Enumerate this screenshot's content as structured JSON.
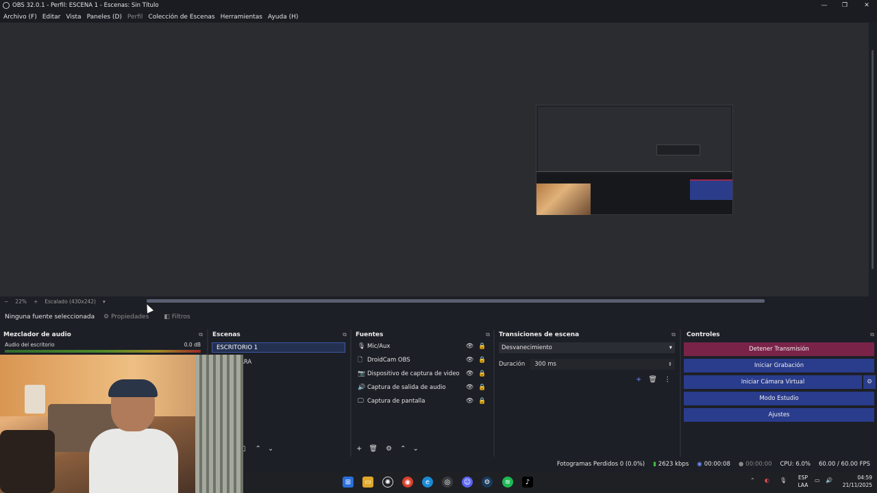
{
  "window": {
    "title": "OBS 32.0.1 - Perfil: ESCENA 1 - Escenas: Sin Título"
  },
  "menu": [
    "Archivo (F)",
    "Editar",
    "Vista",
    "Paneles (D)",
    "Perfil",
    "Colección de Escenas",
    "Herramientas",
    "Ayuda (H)"
  ],
  "zoom": {
    "minus": "−",
    "value": "22%",
    "plus": "+",
    "scale_label": "Escalado (430x242)"
  },
  "source_bar": {
    "no_source": "Ninguna fuente seleccionada",
    "properties": "Propiedades",
    "filters": "Filtros"
  },
  "mixer": {
    "title": "Mezclador de audio",
    "track_name": "Audio del escritorio",
    "track_db": "0.0 dB"
  },
  "scenes": {
    "title": "Escenas",
    "items": [
      "ESCRITORIO 1",
      "ARA"
    ]
  },
  "sources": {
    "title": "Fuentes",
    "items": [
      {
        "icon": "mic-icon",
        "glyph": "🎙",
        "label": "Mic/Aux"
      },
      {
        "icon": "file-icon",
        "glyph": "🗋",
        "label": "DroidCam OBS"
      },
      {
        "icon": "camera-icon",
        "glyph": "📷",
        "label": "Dispositivo de captura de video"
      },
      {
        "icon": "speaker-icon",
        "glyph": "🔊",
        "label": "Captura de salida de audio"
      },
      {
        "icon": "monitor-icon",
        "glyph": "🖵",
        "label": "Captura de pantalla"
      }
    ]
  },
  "transitions": {
    "title": "Transiciones de escena",
    "selected": "Desvanecimiento",
    "duration_label": "Duración",
    "duration_value": "300 ms"
  },
  "controls": {
    "title": "Controles",
    "stop_stream": "Detener Transmisión",
    "start_recording": "Iniciar Grabación",
    "start_virtual_cam": "Iniciar Cámara Virtual",
    "studio_mode": "Modo Estudio",
    "settings": "Ajustes"
  },
  "status": {
    "dropped_frames": "Fotogramas Perdidos 0 (0.0%)",
    "bitrate": "2623 kbps",
    "stream_time": "00:00:08",
    "rec_time": "00:00:00",
    "cpu": "CPU: 6.0%",
    "fps": "60.00 / 60.00 FPS"
  },
  "taskbar": {
    "lang_top": "ESP",
    "lang_bottom": "LAA",
    "time": "04:59",
    "date": "21/11/2025"
  },
  "colors": {
    "accent_blue": "#2a3c8c",
    "stream_red": "#7a2349",
    "panel_bg": "#1d1f26",
    "preview_bg": "#2b2c30"
  }
}
